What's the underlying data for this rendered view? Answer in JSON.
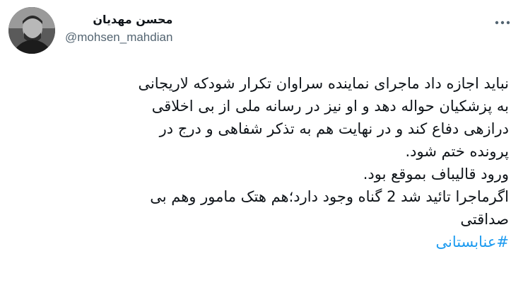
{
  "author": {
    "display_name": "محسن مهدیان",
    "handle": "@mohsen_mahdian"
  },
  "tweet": {
    "lines": [
      "نباید اجازه داد ماجرای نماینده سراوان تکرار شودکه لاریجانی",
      "به پزشکیان حواله دهد و او نیز در رسانه ملی از بی اخلاقی",
      "درازهی دفاع کند و در نهایت هم به تذکر شفاهی و درج در",
      "پرونده ختم شود.",
      "ورود قالیباف بموقع بود.",
      "اگرماجرا تائید شد 2 گناه وجود دارد؛هم هتک مامور وهم بی",
      "صداقتی"
    ],
    "hashtag": "#عنابستانی"
  },
  "icons": {
    "more": "more-horizontal-icon"
  },
  "colors": {
    "text": "#0f1419",
    "secondary": "#536471",
    "link": "#1d9bf0"
  }
}
